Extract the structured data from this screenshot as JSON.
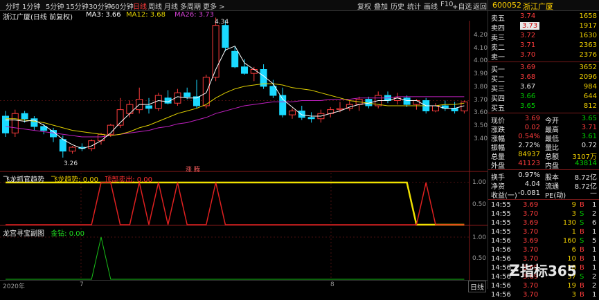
{
  "toolbar": {
    "timeframes": [
      "分时",
      "1分钟",
      "5分钟",
      "15分钟",
      "30分钟",
      "60分钟",
      "日线",
      "周线",
      "月线",
      "多周期",
      "更多 >"
    ],
    "active_timeframe": "日线",
    "right_buttons": [
      "复权",
      "叠加",
      "历史",
      "统计",
      "画线",
      "F10",
      "+自选",
      "返回"
    ]
  },
  "chart_title": {
    "stock": "浙江广厦(日线 前复权)",
    "ma3": "MA3: 3.66",
    "ma12": "MA12: 3.68",
    "ma26": "MA26: 3.73"
  },
  "annotations": {
    "high": "4.34",
    "low": "3.26",
    "event": "涨 腾"
  },
  "y_axis_main": [
    "4.20",
    "4.10",
    "4.00",
    "3.90",
    "3.80",
    "3.70",
    "3.60",
    "3.50",
    "3.40"
  ],
  "indicator1": {
    "title": "飞龙抓官趋势",
    "sub1": "飞龙趋势: 0.00",
    "sub2": "顶部卖出: 0.00",
    "axis": [
      "1.00",
      "0.50"
    ]
  },
  "indicator2": {
    "title": "龙宫寻宝副图",
    "sub1": "金钻: 0.00",
    "axis": [
      "1.00",
      "0.50"
    ]
  },
  "x_axis": {
    "year": "2020年",
    "m1": "7",
    "m2": "8"
  },
  "bottom_tab": "日线",
  "colors": {
    "up": "#ff3c3c",
    "down": "#1ad9ff",
    "ma3": "#ffffff",
    "ma12": "#e0d000",
    "ma26": "#c020c0"
  },
  "chart_data": {
    "type": "candlestick",
    "ohlc": [
      [
        3.58,
        3.62,
        3.42,
        3.45
      ],
      [
        3.45,
        3.63,
        3.42,
        3.6
      ],
      [
        3.6,
        3.62,
        3.53,
        3.56
      ],
      [
        3.56,
        3.58,
        3.47,
        3.5
      ],
      [
        3.5,
        3.52,
        3.44,
        3.47
      ],
      [
        3.47,
        3.49,
        3.38,
        3.42
      ],
      [
        3.4,
        3.43,
        3.26,
        3.31
      ],
      [
        3.31,
        3.35,
        3.29,
        3.34
      ],
      [
        3.34,
        3.37,
        3.31,
        3.33
      ],
      [
        3.33,
        3.4,
        3.31,
        3.39
      ],
      [
        3.39,
        3.45,
        3.36,
        3.44
      ],
      [
        3.44,
        3.52,
        3.42,
        3.51
      ],
      [
        3.51,
        3.72,
        3.49,
        3.63
      ],
      [
        3.6,
        3.7,
        3.57,
        3.67
      ],
      [
        3.63,
        3.8,
        3.6,
        3.71
      ],
      [
        3.66,
        3.72,
        3.6,
        3.64
      ],
      [
        3.64,
        3.76,
        3.62,
        3.74
      ],
      [
        3.72,
        3.78,
        3.67,
        3.68
      ],
      [
        3.68,
        3.79,
        3.66,
        3.76
      ],
      [
        3.76,
        3.8,
        3.71,
        3.73
      ],
      [
        3.73,
        3.86,
        3.64,
        3.66
      ],
      [
        3.66,
        3.9,
        3.64,
        3.88
      ],
      [
        3.88,
        4.34,
        3.85,
        4.28
      ],
      [
        4.28,
        4.32,
        4.08,
        4.11
      ],
      [
        4.08,
        4.12,
        3.95,
        3.96
      ],
      [
        3.96,
        4.02,
        3.9,
        3.91
      ],
      [
        3.91,
        3.96,
        3.85,
        3.94
      ],
      [
        3.94,
        3.98,
        3.79,
        3.81
      ],
      [
        3.81,
        3.86,
        3.72,
        3.74
      ],
      [
        3.74,
        3.8,
        3.57,
        3.59
      ],
      [
        3.59,
        3.64,
        3.56,
        3.62
      ],
      [
        3.62,
        3.66,
        3.55,
        3.57
      ],
      [
        3.57,
        3.61,
        3.53,
        3.56
      ],
      [
        3.56,
        3.63,
        3.53,
        3.6
      ],
      [
        3.6,
        3.65,
        3.57,
        3.63
      ],
      [
        3.63,
        3.69,
        3.61,
        3.64
      ],
      [
        3.64,
        3.7,
        3.62,
        3.67
      ],
      [
        3.67,
        3.73,
        3.62,
        3.71
      ],
      [
        3.71,
        3.73,
        3.64,
        3.66
      ],
      [
        3.66,
        3.77,
        3.64,
        3.74
      ],
      [
        3.74,
        3.77,
        3.68,
        3.7
      ],
      [
        3.7,
        3.76,
        3.67,
        3.72
      ],
      [
        3.72,
        3.74,
        3.65,
        3.67
      ],
      [
        3.67,
        3.71,
        3.63,
        3.7
      ],
      [
        3.7,
        3.72,
        3.6,
        3.62
      ],
      [
        3.62,
        3.68,
        3.61,
        3.66
      ],
      [
        3.66,
        3.7,
        3.62,
        3.64
      ],
      [
        3.64,
        3.69,
        3.6,
        3.62
      ],
      [
        3.62,
        3.7,
        3.6,
        3.69
      ]
    ],
    "ma3": [
      3.55,
      3.55,
      3.54,
      3.55,
      3.51,
      3.46,
      3.4,
      3.36,
      3.33,
      3.35,
      3.39,
      3.45,
      3.53,
      3.6,
      3.67,
      3.67,
      3.7,
      3.69,
      3.73,
      3.72,
      3.72,
      3.76,
      3.94,
      4.09,
      4.12,
      3.99,
      3.94,
      3.89,
      3.83,
      3.71,
      3.65,
      3.59,
      3.58,
      3.58,
      3.6,
      3.62,
      3.65,
      3.67,
      3.68,
      3.7,
      3.7,
      3.72,
      3.7,
      3.7,
      3.66,
      3.66,
      3.64,
      3.64,
      3.66
    ],
    "ma12": [
      3.56,
      3.56,
      3.55,
      3.54,
      3.53,
      3.51,
      3.49,
      3.47,
      3.46,
      3.45,
      3.44,
      3.43,
      3.44,
      3.46,
      3.49,
      3.51,
      3.54,
      3.57,
      3.6,
      3.62,
      3.64,
      3.67,
      3.72,
      3.76,
      3.79,
      3.81,
      3.82,
      3.83,
      3.83,
      3.82,
      3.8,
      3.79,
      3.78,
      3.76,
      3.74,
      3.72,
      3.7,
      3.69,
      3.68,
      3.67,
      3.66,
      3.66,
      3.66,
      3.66,
      3.66,
      3.66,
      3.67,
      3.67,
      3.68
    ],
    "ma26": [
      3.5,
      3.49,
      3.48,
      3.47,
      3.46,
      3.45,
      3.44,
      3.43,
      3.42,
      3.42,
      3.42,
      3.43,
      3.44,
      3.45,
      3.46,
      3.47,
      3.49,
      3.5,
      3.52,
      3.53,
      3.55,
      3.57,
      3.6,
      3.62,
      3.64,
      3.66,
      3.67,
      3.68,
      3.69,
      3.69,
      3.69,
      3.7,
      3.7,
      3.7,
      3.71,
      3.71,
      3.71,
      3.72,
      3.72,
      3.72,
      3.72,
      3.73,
      3.73,
      3.73,
      3.73,
      3.73,
      3.73,
      3.73,
      3.73
    ],
    "trend_yellow": [
      1,
      1,
      1,
      1,
      1,
      1,
      1,
      1,
      1,
      1,
      1,
      1,
      1,
      1,
      1,
      1,
      1,
      1,
      1,
      1,
      1,
      1,
      1,
      1,
      1,
      1,
      1,
      1,
      1,
      1,
      1,
      1,
      1,
      1,
      1,
      1,
      1,
      1,
      1,
      1,
      1,
      1,
      1,
      0,
      0,
      0,
      0,
      0,
      0
    ],
    "sell_red": [
      0,
      0,
      0,
      0,
      0,
      0,
      0,
      0,
      0,
      0,
      1,
      1,
      0,
      0,
      1,
      0,
      1,
      0,
      1,
      0,
      0,
      0,
      1,
      0,
      0,
      0,
      0,
      0,
      0,
      0,
      0,
      0,
      0,
      0,
      0,
      0,
      0,
      0,
      0,
      0,
      0,
      0,
      0,
      0,
      1,
      0,
      0,
      0,
      0
    ],
    "gold": [
      0,
      0,
      0,
      0,
      0,
      0,
      0,
      0,
      0,
      0,
      1,
      0,
      0,
      0,
      0,
      0,
      0,
      0,
      0,
      0,
      0,
      0,
      0,
      0,
      0,
      0,
      0,
      0,
      0,
      0,
      0,
      0,
      0,
      0,
      0,
      0,
      0,
      0,
      0,
      0,
      0,
      0,
      0,
      0,
      0,
      0,
      0,
      0,
      0
    ]
  },
  "quote": {
    "code": "600052",
    "name": "浙江广厦",
    "sells": [
      {
        "label": "卖五",
        "price": "3.74",
        "vol": "1658"
      },
      {
        "label": "卖四",
        "price": "3.73",
        "vol": "1917"
      },
      {
        "label": "卖三",
        "price": "3.72",
        "vol": "1630"
      },
      {
        "label": "卖二",
        "price": "3.71",
        "vol": "2363"
      },
      {
        "label": "卖一",
        "price": "3.70",
        "vol": "2376"
      }
    ],
    "buys": [
      {
        "label": "买一",
        "price": "3.69",
        "vol": "3652"
      },
      {
        "label": "买二",
        "price": "3.68",
        "vol": "2096"
      },
      {
        "label": "买三",
        "price": "3.67",
        "vol": "984"
      },
      {
        "label": "买四",
        "price": "3.66",
        "vol": "644"
      },
      {
        "label": "买五",
        "price": "3.65",
        "vol": "812"
      }
    ],
    "stats": [
      {
        "l1": "现价",
        "v1": "3.69",
        "l2": "今开",
        "v2": "3.65"
      },
      {
        "l1": "涨跌",
        "v1": "0.02",
        "l2": "最高",
        "v2": "3.71"
      },
      {
        "l1": "涨幅",
        "v1": "0.54%",
        "l2": "最低",
        "v2": "3.61"
      },
      {
        "l1": "振幅",
        "v1": "2.72%",
        "l2": "量比",
        "v2": "0.72"
      },
      {
        "l1": "总量",
        "v1": "84937",
        "l2": "总额",
        "v2": "3107万"
      },
      {
        "l1": "外盘",
        "v1": "41123",
        "l2": "内盘",
        "v2": "43814"
      }
    ],
    "stats2": [
      {
        "l1": "换手",
        "v1": "0.97%",
        "l2": "股本",
        "v2": "8.72亿"
      },
      {
        "l1": "净资",
        "v1": "4.04",
        "l2": "流通",
        "v2": "8.72亿"
      },
      {
        "l1": "收益(一)",
        "v1": "-0.081",
        "l2": "PE(动)",
        "v2": "—"
      }
    ],
    "ticks": [
      {
        "t": "14:55",
        "p": "3.69",
        "v": "9",
        "d": "B",
        "n": "1"
      },
      {
        "t": "14:55",
        "p": "3.70",
        "v": "3",
        "d": "S",
        "n": "2"
      },
      {
        "t": "14:55",
        "p": "3.69",
        "v": "130",
        "d": "S",
        "n": "6"
      },
      {
        "t": "14:55",
        "p": "3.70",
        "v": "1",
        "d": "B",
        "n": "1"
      },
      {
        "t": "14:56",
        "p": "3.69",
        "v": "160",
        "d": "S",
        "n": "5"
      },
      {
        "t": "14:56",
        "p": "3.70",
        "v": "6",
        "d": "B",
        "n": "1"
      },
      {
        "t": "14:56",
        "p": "3.70",
        "v": "10",
        "d": "B",
        "n": "1"
      },
      {
        "t": "14:56",
        "p": "3.69",
        "v": "10",
        "d": "B",
        "n": "1"
      },
      {
        "t": "14:56",
        "p": "3.69",
        "v": "37",
        "d": "S",
        "n": "2"
      },
      {
        "t": "14:56",
        "p": "3.70",
        "v": "19",
        "d": "B",
        "n": "2"
      },
      {
        "t": "14:56",
        "p": "3.70",
        "v": "3",
        "d": "B",
        "n": "1"
      }
    ]
  },
  "logo": "指标365"
}
